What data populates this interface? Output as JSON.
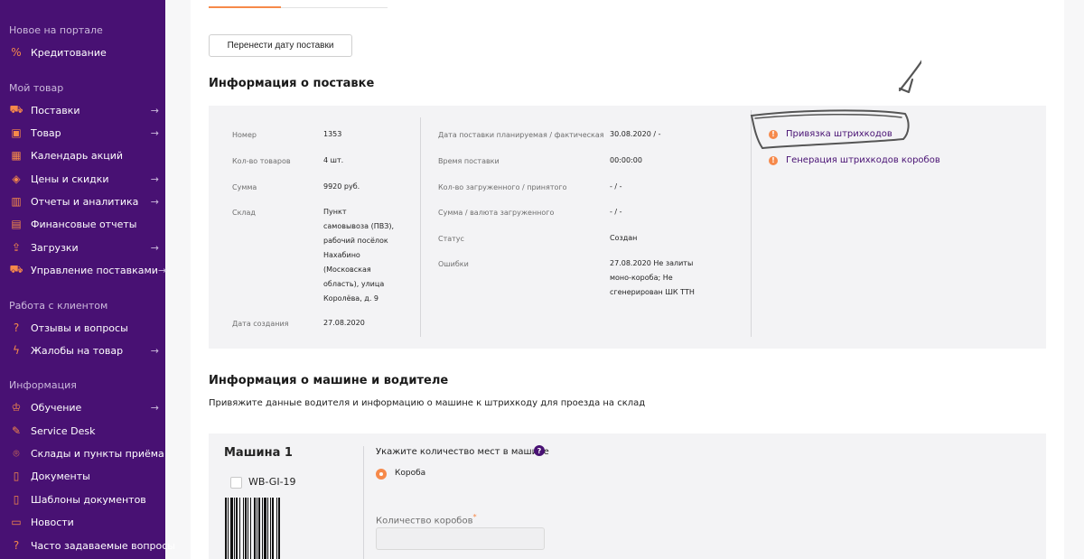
{
  "sidebar": {
    "sections": [
      {
        "title": "Новое на портале",
        "items": [
          {
            "label": "Кредитование",
            "icon": "percent-icon",
            "arrow": false
          }
        ]
      },
      {
        "title": "Мой товар",
        "items": [
          {
            "label": "Поставки",
            "icon": "truck-icon",
            "arrow": true
          },
          {
            "label": "Товар",
            "icon": "box-icon",
            "arrow": true
          },
          {
            "label": "Календарь акций",
            "icon": "calendar-icon",
            "arrow": false
          },
          {
            "label": "Цены и скидки",
            "icon": "tag-icon",
            "arrow": true
          },
          {
            "label": "Отчеты и аналитика",
            "icon": "chart-icon",
            "arrow": true
          },
          {
            "label": "Финансовые отчеты",
            "icon": "document-list-icon",
            "arrow": false
          },
          {
            "label": "Загрузки",
            "icon": "upload-icon",
            "arrow": true
          },
          {
            "label": "Управление поставками",
            "icon": "delivery-icon",
            "arrow": true
          }
        ]
      },
      {
        "title": "Работа с клиентом",
        "items": [
          {
            "label": "Отзывы и вопросы",
            "icon": "question-icon",
            "arrow": false
          },
          {
            "label": "Жалобы на товар",
            "icon": "lightning-icon",
            "arrow": true
          }
        ]
      },
      {
        "title": "Информация",
        "items": [
          {
            "label": "Обучение",
            "icon": "graduation-icon",
            "arrow": true
          },
          {
            "label": "Service Desk",
            "icon": "wrench-icon",
            "arrow": false
          },
          {
            "label": "Склады и пункты приёма",
            "icon": "location-pin-icon",
            "arrow": false
          },
          {
            "label": "Документы",
            "icon": "document-icon",
            "arrow": false
          },
          {
            "label": "Шаблоны документов",
            "icon": "document-template-icon",
            "arrow": false
          },
          {
            "label": "Новости",
            "icon": "book-icon",
            "arrow": false
          },
          {
            "label": "Часто задаваемые вопросы",
            "icon": "faq-icon",
            "arrow": false
          }
        ]
      }
    ]
  },
  "toolbar": {
    "move_date_button": "Перенести дату поставки"
  },
  "supply_info": {
    "title": "Информация о поставке",
    "left": [
      {
        "label": "Номер",
        "value": "1353"
      },
      {
        "label": "Кол-во товаров",
        "value": "4 шт."
      },
      {
        "label": "Сумма",
        "value": "9920 руб."
      },
      {
        "label": "Склад",
        "value_lines": [
          "Пункт",
          "самовывоза (ПВЗ),",
          "рабочий посёлок",
          "Нахабино",
          "(Московская",
          "область), улица",
          "Королёва, д. 9"
        ]
      },
      {
        "label": "Дата создания",
        "value": "27.08.2020"
      }
    ],
    "middle": [
      {
        "label": "Дата поставки планируемая / фактическая",
        "value": "30.08.2020 / -"
      },
      {
        "label": "Время поставки",
        "value": "00:00:00"
      },
      {
        "label": "Кол-во загруженного / принятого",
        "value": "- / -"
      },
      {
        "label": "Сумма / валюта загруженного",
        "value": "- / -"
      },
      {
        "label": "Статус",
        "value": "Создан"
      },
      {
        "label": "Ошибки",
        "value_lines": [
          "27.08.2020 Не залиты",
          "моно-короба; Не",
          "сгенерирован ШК ТТН"
        ]
      }
    ],
    "links": [
      {
        "label": "Привязка штрихкодов",
        "icon": "warning-icon"
      },
      {
        "label": "Генерация штрихкодов коробов",
        "icon": "warning-icon"
      }
    ]
  },
  "vehicle": {
    "title": "Информация о машине и водителе",
    "description": "Привяжите данные водителя и информацию о машине к штрихкоду для проезда на склад",
    "car_title": "Машина 1",
    "barcode_code": "WB-GI-19",
    "places_label": "Укажите количество мест в машине",
    "help_icon": "?",
    "radio_label": "Короба",
    "boxes_label": "Количество коробов",
    "required_mark": "*",
    "boxes_value": ""
  },
  "colors": {
    "sidebar": "#481173",
    "accent": "#f6894a",
    "link": "#481173"
  }
}
